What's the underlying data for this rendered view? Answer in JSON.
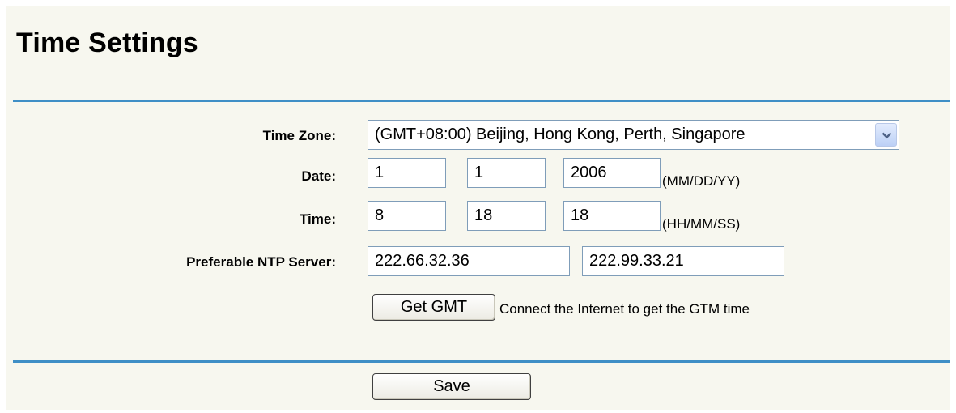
{
  "page": {
    "title": "Time Settings"
  },
  "form": {
    "time_zone": {
      "label": "Time Zone:",
      "selected": "(GMT+08:00) Beijing, Hong Kong, Perth, Singapore"
    },
    "date": {
      "label": "Date:",
      "month": "1",
      "day": "1",
      "year": "2006",
      "format_hint": "(MM/DD/YY)"
    },
    "time": {
      "label": "Time:",
      "hour": "8",
      "minute": "18",
      "second": "18",
      "format_hint": "(HH/MM/SS)"
    },
    "ntp": {
      "label": "Preferable NTP Server:",
      "primary": "222.66.32.36",
      "secondary": "222.99.33.21"
    },
    "get_gmt": {
      "button_label": "Get GMT",
      "description": "Connect the Internet to get the GTM time"
    }
  },
  "footer": {
    "save_label": "Save"
  },
  "colors": {
    "background": "#f7f7ef",
    "rule": "#3f8fc6"
  },
  "icons": {
    "dropdown": "chevron-down-icon"
  }
}
